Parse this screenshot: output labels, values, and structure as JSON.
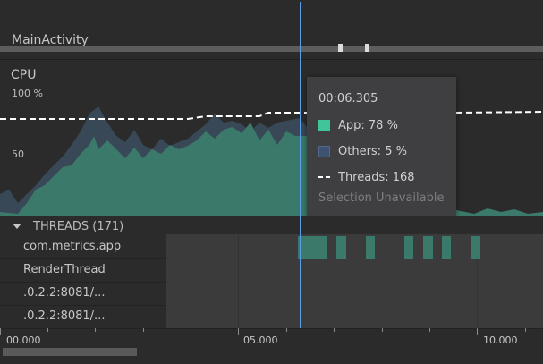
{
  "activity": {
    "label": "MainActivity"
  },
  "cpu": {
    "label": "CPU",
    "ytick_100": "100 %",
    "ytick_50": "50",
    "colors": {
      "app": "#3b7a6a",
      "others": "#3a4a5a",
      "threads_line": "#ffffff"
    }
  },
  "tooltip": {
    "time": "00:06.305",
    "app_label": "App: 78 %",
    "others_label": "Others:  5 %",
    "threads_label": "Threads: 168",
    "unavailable": "Selection Unavailable",
    "app_color": "#40c49a",
    "others_color": "#3e5374"
  },
  "threads": {
    "title": "THREADS (171)",
    "items": [
      {
        "name": "com.metrics.app"
      },
      {
        "name": "RenderThread"
      },
      {
        "name": ".0.2.2:8081/..."
      },
      {
        "name": ".0.2.2:8081/..."
      }
    ]
  },
  "axis": {
    "labels": [
      "00.000",
      "05.000",
      "10.000"
    ]
  }
}
